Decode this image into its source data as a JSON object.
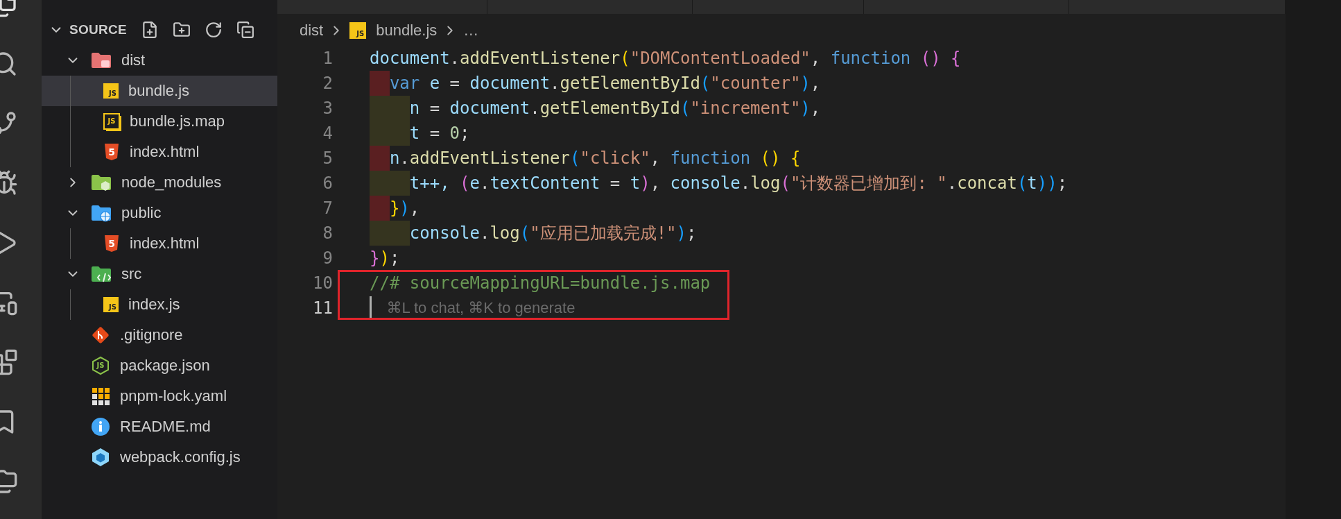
{
  "sidebar": {
    "header": {
      "title": "SOURCE",
      "expanded": true
    },
    "items": [
      {
        "label": "dist",
        "kind": "folder",
        "icon": {
          "kind": "dist"
        },
        "expanded": true,
        "selected": false,
        "children": [
          {
            "label": "bundle.js",
            "kind": "file",
            "icon": {
              "kind": "js",
              "text": "JS"
            },
            "selected": true
          },
          {
            "label": "bundle.js.map",
            "kind": "file",
            "icon": {
              "kind": "jsmap",
              "text": "JS"
            },
            "selected": false
          },
          {
            "label": "index.html",
            "kind": "file",
            "icon": {
              "kind": "html",
              "text": "5"
            },
            "selected": false
          }
        ]
      },
      {
        "label": "node_modules",
        "kind": "folder",
        "icon": {
          "kind": "node"
        },
        "expanded": false,
        "selected": false
      },
      {
        "label": "public",
        "kind": "folder",
        "icon": {
          "kind": "public"
        },
        "expanded": true,
        "selected": false,
        "children": [
          {
            "label": "index.html",
            "kind": "file",
            "icon": {
              "kind": "html",
              "text": "5"
            },
            "selected": false
          }
        ]
      },
      {
        "label": "src",
        "kind": "folder",
        "icon": {
          "kind": "src"
        },
        "expanded": true,
        "selected": false,
        "children": [
          {
            "label": "index.js",
            "kind": "file",
            "icon": {
              "kind": "js",
              "text": "JS"
            },
            "selected": false
          }
        ]
      },
      {
        "label": ".gitignore",
        "kind": "file",
        "icon": {
          "kind": "git"
        },
        "selected": false
      },
      {
        "label": "package.json",
        "kind": "file",
        "icon": {
          "kind": "npm",
          "text": "JS"
        },
        "selected": false
      },
      {
        "label": "pnpm-lock.yaml",
        "kind": "file",
        "icon": {
          "kind": "pnpm"
        },
        "selected": false
      },
      {
        "label": "README.md",
        "kind": "file",
        "icon": {
          "kind": "info"
        },
        "selected": false
      },
      {
        "label": "webpack.config.js",
        "kind": "file",
        "icon": {
          "kind": "webpack"
        },
        "selected": false
      }
    ]
  },
  "breadcrumb": {
    "folder": "dist",
    "file": "bundle.js",
    "file_icon": {
      "kind": "js",
      "text": "JS"
    },
    "more": "…"
  },
  "editor": {
    "lines": [
      {
        "number": "1",
        "current": false,
        "tokens": [
          {
            "text": "document",
            "color": "#9cdcfe"
          },
          {
            "text": ".",
            "color": "#d4d4d4"
          },
          {
            "text": "addEventListener",
            "color": "#dcdcaa"
          },
          {
            "text": "(",
            "color": "#ffd700"
          },
          {
            "text": "\"DOMContentLoaded\"",
            "color": "#ce9178"
          },
          {
            "text": ", ",
            "color": "#d4d4d4"
          },
          {
            "text": "function",
            "color": "#569cd6"
          },
          {
            "text": " ()",
            "color": "#da70d6"
          },
          {
            "text": " {",
            "color": "#da70d6"
          }
        ]
      },
      {
        "number": "2",
        "current": false,
        "mark": {
          "kind": "narrow",
          "color": "#5a1f21"
        },
        "tokens": [
          {
            "text": "var",
            "color": "#569cd6"
          },
          {
            "text": " e",
            "color": "#9cdcfe"
          },
          {
            "text": " = ",
            "color": "#d4d4d4"
          },
          {
            "text": "document",
            "color": "#9cdcfe"
          },
          {
            "text": ".",
            "color": "#d4d4d4"
          },
          {
            "text": "getElementById",
            "color": "#dcdcaa"
          },
          {
            "text": "(",
            "color": "#179fff"
          },
          {
            "text": "\"counter\"",
            "color": "#ce9178"
          },
          {
            "text": ")",
            "color": "#179fff"
          },
          {
            "text": ",",
            "color": "#d4d4d4"
          }
        ]
      },
      {
        "number": "3",
        "current": false,
        "mark": {
          "kind": "wide",
          "color": "#35341f"
        },
        "tokens": [
          {
            "text": "n",
            "color": "#9cdcfe"
          },
          {
            "text": " = ",
            "color": "#d4d4d4"
          },
          {
            "text": "document",
            "color": "#9cdcfe"
          },
          {
            "text": ".",
            "color": "#d4d4d4"
          },
          {
            "text": "getElementById",
            "color": "#dcdcaa"
          },
          {
            "text": "(",
            "color": "#179fff"
          },
          {
            "text": "\"increment\"",
            "color": "#ce9178"
          },
          {
            "text": ")",
            "color": "#179fff"
          },
          {
            "text": ",",
            "color": "#d4d4d4"
          }
        ]
      },
      {
        "number": "4",
        "current": false,
        "mark": {
          "kind": "wide",
          "color": "#35341f"
        },
        "tokens": [
          {
            "text": "t",
            "color": "#9cdcfe"
          },
          {
            "text": " = ",
            "color": "#d4d4d4"
          },
          {
            "text": "0",
            "color": "#b5cea8"
          },
          {
            "text": ";",
            "color": "#d4d4d4"
          }
        ]
      },
      {
        "number": "5",
        "current": false,
        "mark": {
          "kind": "narrow",
          "color": "#5a1f21"
        },
        "tokens": [
          {
            "text": "n",
            "color": "#9cdcfe"
          },
          {
            "text": ".",
            "color": "#d4d4d4"
          },
          {
            "text": "addEventListener",
            "color": "#dcdcaa"
          },
          {
            "text": "(",
            "color": "#179fff"
          },
          {
            "text": "\"click\"",
            "color": "#ce9178"
          },
          {
            "text": ", ",
            "color": "#d4d4d4"
          },
          {
            "text": "function",
            "color": "#569cd6"
          },
          {
            "text": " ()",
            "color": "#ffd700"
          },
          {
            "text": " {",
            "color": "#ffd700"
          }
        ]
      },
      {
        "number": "6",
        "current": false,
        "mark": {
          "kind": "wide",
          "color": "#35341f"
        },
        "tokens": [
          {
            "text": "t++, ",
            "color": "#9cdcfe"
          },
          {
            "text": "(",
            "color": "#da70d6"
          },
          {
            "text": "e",
            "color": "#9cdcfe"
          },
          {
            "text": ".",
            "color": "#d4d4d4"
          },
          {
            "text": "textContent",
            "color": "#9cdcfe"
          },
          {
            "text": " = ",
            "color": "#d4d4d4"
          },
          {
            "text": "t",
            "color": "#9cdcfe"
          },
          {
            "text": ")",
            "color": "#da70d6"
          },
          {
            "text": ", ",
            "color": "#d4d4d4"
          },
          {
            "text": "console",
            "color": "#9cdcfe"
          },
          {
            "text": ".",
            "color": "#d4d4d4"
          },
          {
            "text": "log",
            "color": "#dcdcaa"
          },
          {
            "text": "(",
            "color": "#da70d6"
          },
          {
            "text": "\"计数器已增加到: \"",
            "color": "#ce9178"
          },
          {
            "text": ".",
            "color": "#d4d4d4"
          },
          {
            "text": "concat",
            "color": "#dcdcaa"
          },
          {
            "text": "(",
            "color": "#179fff"
          },
          {
            "text": "t",
            "color": "#9cdcfe"
          },
          {
            "text": "))",
            "color": "#179fff"
          },
          {
            "text": ";",
            "color": "#d4d4d4"
          }
        ]
      },
      {
        "number": "7",
        "current": false,
        "mark": {
          "kind": "narrow",
          "color": "#5a1f21"
        },
        "tokens": [
          {
            "text": "}",
            "color": "#ffd700"
          },
          {
            "text": ")",
            "color": "#179fff"
          },
          {
            "text": ",",
            "color": "#d4d4d4"
          }
        ]
      },
      {
        "number": "8",
        "current": false,
        "mark": {
          "kind": "wide",
          "color": "#35341f"
        },
        "tokens": [
          {
            "text": "console",
            "color": "#9cdcfe"
          },
          {
            "text": ".",
            "color": "#d4d4d4"
          },
          {
            "text": "log",
            "color": "#dcdcaa"
          },
          {
            "text": "(",
            "color": "#179fff"
          },
          {
            "text": "\"应用已加载完成!\"",
            "color": "#ce9178"
          },
          {
            "text": ")",
            "color": "#179fff"
          },
          {
            "text": ";",
            "color": "#d4d4d4"
          }
        ]
      },
      {
        "number": "9",
        "current": false,
        "tokens": [
          {
            "text": "}",
            "color": "#da70d6"
          },
          {
            "text": ")",
            "color": "#ffd700"
          },
          {
            "text": ";",
            "color": "#d4d4d4"
          }
        ]
      },
      {
        "number": "10",
        "current": false,
        "tokens": [
          {
            "text": "//# sourceMappingURL=bundle.js.map",
            "color": "#6a9955"
          }
        ]
      },
      {
        "number": "11",
        "current": true,
        "hint": "⌘L to chat, ⌘K to generate"
      }
    ]
  }
}
